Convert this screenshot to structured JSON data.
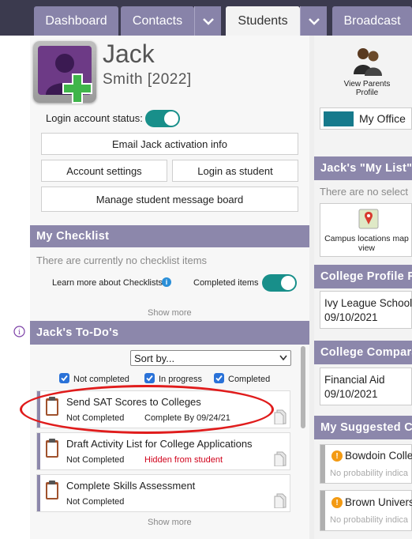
{
  "nav": {
    "tabs": [
      {
        "label": "Dashboard"
      },
      {
        "label": "Contacts"
      },
      {
        "label": "Students"
      },
      {
        "label": "Broadcast"
      }
    ]
  },
  "student": {
    "first_name": "Jack",
    "last_line": "Smith [2022]"
  },
  "login": {
    "label": "Login account status:",
    "enabled": true
  },
  "buttons": {
    "email_activation": "Email Jack activation info",
    "account_settings": "Account settings",
    "login_as_student": "Login as student",
    "manage_board": "Manage student message board"
  },
  "checklist": {
    "title": "My Checklist",
    "empty": "There are currently no checklist items",
    "learn_more": "Learn more about Checklists",
    "completed_items": "Completed items",
    "show_more": "Show more"
  },
  "todos": {
    "title": "Jack's To-Do's",
    "sort_label": "Sort by...",
    "filters": [
      {
        "label": "Not completed",
        "checked": true
      },
      {
        "label": "In progress",
        "checked": true
      },
      {
        "label": "Completed",
        "checked": true
      }
    ],
    "items": [
      {
        "title": "Send SAT Scores to Colleges",
        "status": "Not Completed",
        "extra": "Complete By 09/24/21",
        "extra_color": "#222222"
      },
      {
        "title": "Draft Activity List for College Applications",
        "status": "Not Completed",
        "extra": "Hidden from student",
        "extra_color": "#d0021b"
      },
      {
        "title": "Complete Skills Assessment",
        "status": "Not Completed",
        "extra": "",
        "extra_color": "#222222"
      }
    ],
    "show_more": "Show more"
  },
  "right": {
    "view_parents": "View Parents Profile",
    "my_office": "My Office",
    "my_list_title": "Jack's \"My List\" o",
    "my_list_empty": "There are no select",
    "campus_map": "Campus locations map view",
    "college_profile_title": "College Profile Re",
    "college_profile_item": {
      "name": "Ivy League Schools",
      "date": "09/10/2021"
    },
    "college_comparison_title": "College Comparati",
    "college_comparison_item": {
      "name": "Financial Aid",
      "date": "09/10/2021"
    },
    "suggested_title": "My Suggested Co",
    "suggested": [
      {
        "name": "Bowdoin Colle",
        "note": "No probability indica"
      },
      {
        "name": "Brown Univers",
        "note": "No probability indica"
      }
    ]
  },
  "colors": {
    "accent": "#8c87ab",
    "nav_bg": "#3b3a4e",
    "toggle_on": "#188f8a",
    "office_swatch": "#167a8c",
    "annotation": "#e01c1c"
  }
}
